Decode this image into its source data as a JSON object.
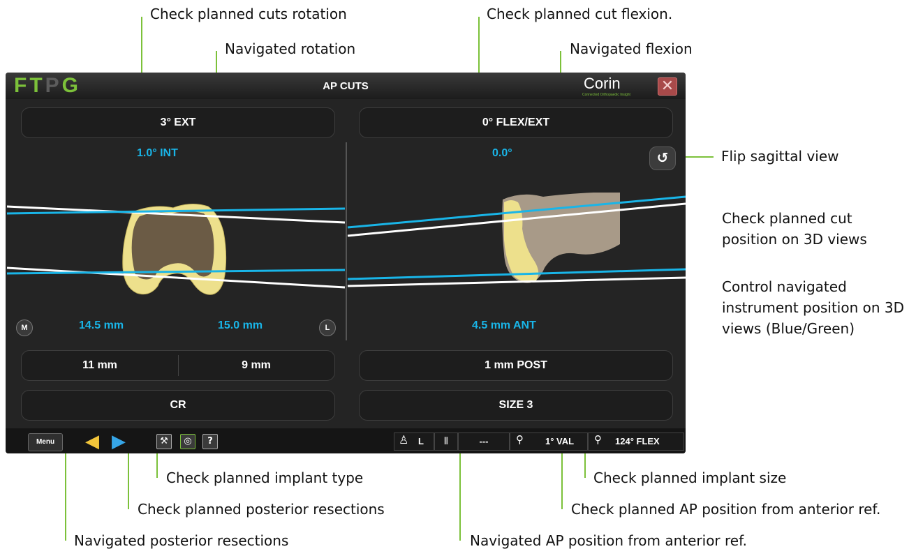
{
  "annotations": {
    "planned_cuts_rotation": "Check planned cuts rotation",
    "navigated_rotation": "Navigated rotation",
    "planned_cut_flexion": "Check planned cut flexion.",
    "navigated_flexion": "Navigated flexion",
    "flip_sagittal_view": "Flip sagittal view",
    "check_cut_position": "Check planned cut position on 3D views",
    "control_instrument": "Control navigated instrument position on 3D views (Blue/Green)",
    "planned_implant_type": "Check planned implant type",
    "planned_implant_size": "Check planned implant size",
    "planned_posterior_resections": "Check planned posterior resections",
    "planned_ap_position": "Check planned AP position from anterior ref.",
    "navigated_posterior_resections": "Navigated posterior resections",
    "navigated_ap_position": "Navigated AP position from anterior ref."
  },
  "app": {
    "logo_letters": [
      "F",
      "T",
      "P",
      "G"
    ],
    "title": "AP CUTS",
    "brand": "Corin",
    "brand_tagline": "Connected Orthopaedic Insight",
    "close_symbol": "✕"
  },
  "left": {
    "planned_rotation": "3° EXT",
    "navigated_rotation": "1.0° INT",
    "medial_marker": "M",
    "lateral_marker": "L",
    "navigated_medial": "14.5 mm",
    "navigated_lateral": "15.0 mm",
    "planned_medial": "11 mm",
    "planned_lateral": "9 mm",
    "implant_type": "CR"
  },
  "right": {
    "planned_flexion": "0° FLEX/EXT",
    "navigated_flexion": "0.0°",
    "flip_symbol": "↺",
    "navigated_ap": "4.5 mm ANT",
    "planned_ap": "1 mm POST",
    "implant_size": "SIZE 3"
  },
  "bottom_bar": {
    "menu_label": "Menu",
    "prev_icon": "◀",
    "next_icon": "▶",
    "tools_icon": "⚒",
    "camera_icon": "◎",
    "help_label": "?",
    "side_label": "L",
    "dash_value": "---",
    "varus_valgus": "1° VAL",
    "flexion": "124° FLEX"
  },
  "colors": {
    "accent_green": "#7cc13a",
    "navigated_blue": "#19b5e8",
    "planned_white": "#ffffff",
    "bone_yellow": "#ede08c",
    "cut_surface": "#6b5b45"
  }
}
